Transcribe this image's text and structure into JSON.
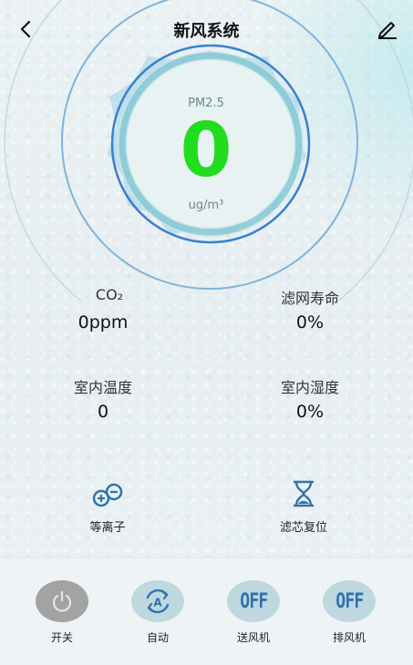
{
  "header": {
    "title": "新风系统",
    "back_icon": "back-chevron-icon",
    "edit_icon": "edit-pencil-icon"
  },
  "gauge": {
    "label": "PM2.5",
    "value": "0",
    "unit": "ug/m³",
    "value_color": "#22dd1e"
  },
  "stats": {
    "co2": {
      "label": "CO₂",
      "value": "0ppm"
    },
    "filter_life": {
      "label": "滤网寿命",
      "value": "0%"
    },
    "indoor_temp": {
      "label": "室内温度",
      "value": "0"
    },
    "indoor_humidity": {
      "label": "室内湿度",
      "value": "0%"
    }
  },
  "features": {
    "plasma": {
      "label": "等离子",
      "icon": "plasma-icon"
    },
    "filter_reset": {
      "label": "滤芯复位",
      "icon": "hourglass-icon"
    }
  },
  "controls": {
    "power": {
      "label": "开关",
      "icon": "power-icon"
    },
    "auto": {
      "label": "自动",
      "icon": "auto-icon",
      "icon_text": "A"
    },
    "supply_fan": {
      "label": "送风机",
      "state": "OFF"
    },
    "exhaust_fan": {
      "label": "排风机",
      "state": "OFF"
    }
  },
  "colors": {
    "accent": "#2d73ad",
    "ring": "#3a7fd0",
    "background": "#e9f1f3"
  }
}
